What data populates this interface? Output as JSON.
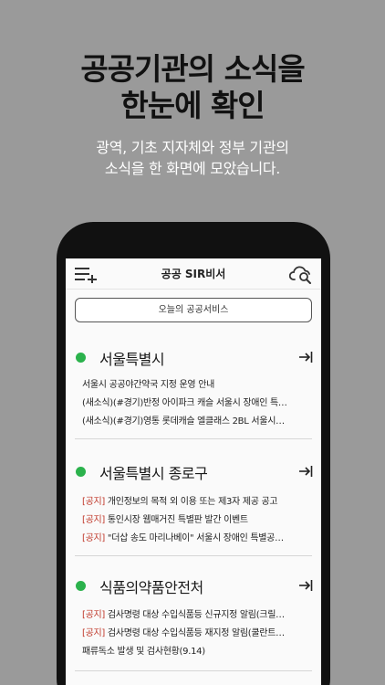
{
  "promo": {
    "title_line1": "공공기관의 소식을",
    "title_line2": "한눈에 확인",
    "sub_line1": "광역, 기초 지자체와 정부 기관의",
    "sub_line2": "소식을 한 화면에 모았습니다."
  },
  "header": {
    "title": "공공 SIR비서",
    "menu_icon": "menu-add-icon",
    "search_icon": "cloud-search-icon"
  },
  "today_button": "오늘의 공공서비스",
  "accent_color": "#2bb24c",
  "tag_color": "#c0392b",
  "sections": [
    {
      "title": "서울특별시",
      "items": [
        {
          "tag": "",
          "text": "서울시 공공야간약국 지정 운영 안내"
        },
        {
          "tag": "",
          "text": "(새소식)(#경기)반정 아이파크 캐슬 서울시 장애인 특…"
        },
        {
          "tag": "",
          "text": "(새소식)(#경기)영통 롯데캐슬 엘클래스 2BL 서울시…"
        }
      ]
    },
    {
      "title": "서울특별시 종로구",
      "items": [
        {
          "tag": "[공지]",
          "text": " 개인정보의 목적 외 이용 또는 제3자 제공 공고"
        },
        {
          "tag": "[공지]",
          "text": " 통인시장 웹매거진 특별판 발간 이벤트"
        },
        {
          "tag": "[공지]",
          "text": " \"더삽 송도 마리나베이\" 서울시 장애인 특별공…"
        }
      ]
    },
    {
      "title": "식품의약품안전처",
      "items": [
        {
          "tag": "[공지]",
          "text": " 검사명령 대상 수입식품등 신규지정 알림(크릴…"
        },
        {
          "tag": "[공지]",
          "text": " 검사명령 대상 수입식품등 재지정 알림(쿨란트…"
        },
        {
          "tag": "",
          "text": "패류독소 발생 및 검사현황(9.14)"
        }
      ]
    }
  ]
}
